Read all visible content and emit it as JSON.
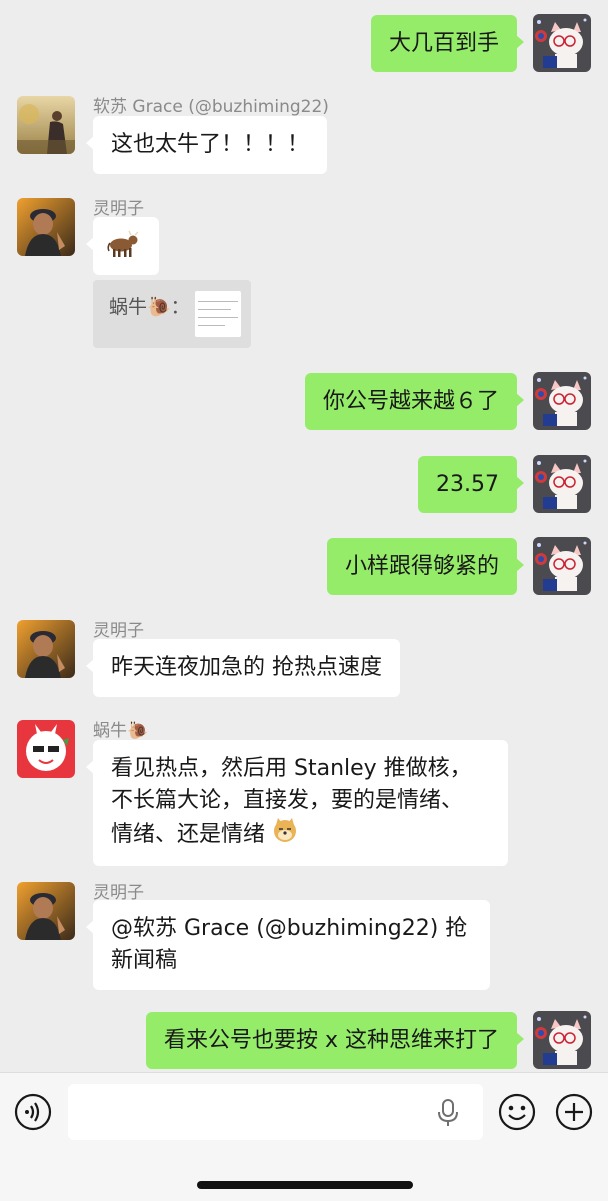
{
  "chat": {
    "messages": [
      {
        "text": "大几百到手"
      },
      {
        "sender": "软苏 Grace (@buzhiming22)",
        "text": "这也太牛了！！！！"
      },
      {
        "sender": "灵明子",
        "text": "🐂",
        "quote": {
          "text": "蜗牛🐌："
        }
      },
      {
        "text": "你公号越来越６了"
      },
      {
        "text": "23.57"
      },
      {
        "text": "小样跟得够紧的"
      },
      {
        "sender": "灵明子",
        "text": "昨天连夜加急的 抢热点速度"
      },
      {
        "sender": "蜗牛🐌",
        "lines": [
          "看见热点，然后用 Stanley 推做核，",
          "不长篇大论，直接发，要的是情绪、",
          "情绪、还是情绪"
        ]
      },
      {
        "sender": "灵明子",
        "lines": [
          "@软苏 Grace (@buzhiming22) 抢",
          "新闻稿"
        ]
      },
      {
        "text": "看来公号也要按 x 这种思维来打了"
      }
    ]
  },
  "input_bar": {
    "left_icon": "voice-icon",
    "mic_icon": "microphone-icon",
    "emoji_icon": "emoji-icon",
    "plus_icon": "plus-icon"
  },
  "colors": {
    "outgoing_bubble": "#95ec69",
    "incoming_bubble": "#ffffff",
    "background": "#ededed"
  }
}
